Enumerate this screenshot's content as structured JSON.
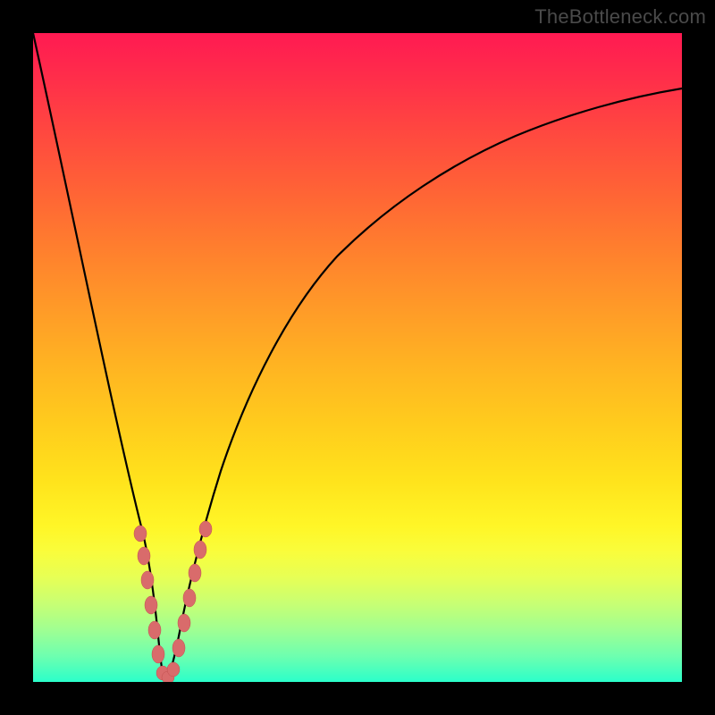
{
  "watermark": "TheBottleneck.com",
  "chart_data": {
    "type": "line",
    "title": "",
    "xlabel": "",
    "ylabel": "",
    "xlim": [
      0,
      100
    ],
    "ylim": [
      0,
      100
    ],
    "grid": false,
    "legend": false,
    "series": [
      {
        "name": "curve",
        "x": [
          0,
          2,
          4,
          6,
          8,
          10,
          12,
          14,
          16,
          17,
          18,
          19,
          20,
          21,
          22,
          23,
          25,
          27,
          30,
          35,
          40,
          45,
          50,
          55,
          60,
          65,
          70,
          75,
          80,
          85,
          90,
          95,
          100
        ],
        "y": [
          100,
          90,
          80,
          70,
          60,
          50,
          40,
          30,
          18,
          10,
          4,
          0,
          0,
          3,
          8,
          14,
          24,
          32,
          42,
          54,
          62,
          68,
          73,
          76.5,
          79.5,
          82,
          84,
          85.8,
          87.3,
          88.5,
          89.5,
          90.3,
          91
        ],
        "color": "#000000"
      },
      {
        "name": "markers",
        "x": [
          14.5,
          15.2,
          15.8,
          16.4,
          17.0,
          17.8,
          18.6,
          19.3,
          20.2,
          21.2,
          22.0,
          22.6,
          23.2,
          23.7,
          24.3
        ],
        "y": [
          23,
          19,
          15,
          12,
          8,
          5,
          2,
          1,
          1,
          3,
          7,
          11,
          15,
          19,
          23
        ],
        "color": "#d96b6b",
        "marker": "circle"
      }
    ]
  },
  "colors": {
    "frame": "#000000",
    "curve": "#000000",
    "marker_fill": "#d96b6b",
    "marker_stroke": "#c24f4f"
  }
}
